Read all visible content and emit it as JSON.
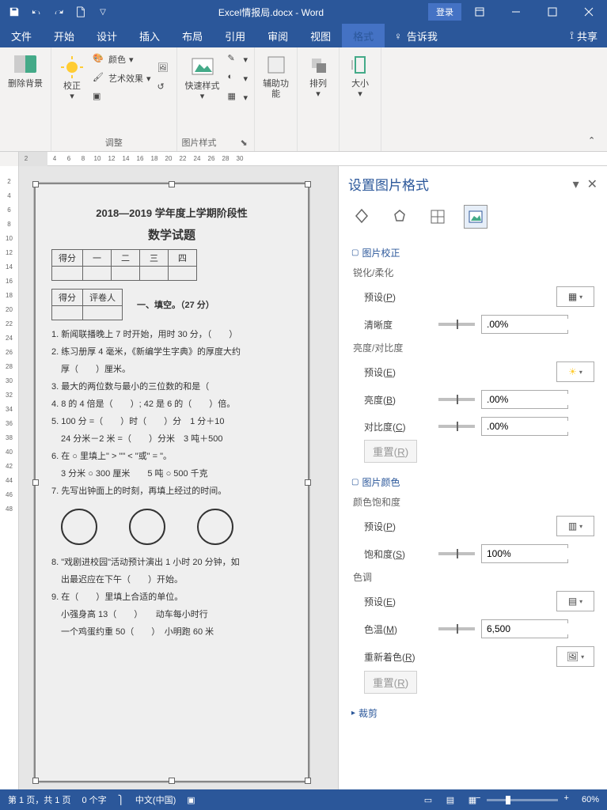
{
  "titlebar": {
    "document_name": "Excel情报局.docx  -  Word",
    "login": "登录"
  },
  "tabs": {
    "file": "文件",
    "home": "开始",
    "design": "设计",
    "insert": "插入",
    "layout": "布局",
    "references": "引用",
    "review": "审阅",
    "view": "视图",
    "format": "格式",
    "tell_me": "告诉我",
    "share": "共享"
  },
  "ribbon": {
    "remove_bg": "删除背景",
    "corrections": "校正",
    "adjust_label": "调整",
    "color": "颜色",
    "artistic": "艺术效果",
    "quick_styles": "快速样式",
    "picture_styles_label": "图片样式",
    "accessibility": "辅助功\n能",
    "arrange": "排列",
    "size": "大小"
  },
  "ruler_h": [
    "2",
    "",
    "4",
    "6",
    "8",
    "10",
    "12",
    "14",
    "16",
    "18",
    "20",
    "22",
    "24",
    "26",
    "28",
    "30"
  ],
  "ruler_v": [
    "2",
    "4",
    "6",
    "8",
    "10",
    "12",
    "14",
    "16",
    "18",
    "20",
    "22",
    "24",
    "26",
    "28",
    "30",
    "32",
    "34",
    "36",
    "38",
    "40",
    "42",
    "44",
    "46",
    "48"
  ],
  "document": {
    "header": "2018—2019 学年度上学期阶段性",
    "subject": "数学试题",
    "row1": [
      "得分",
      "一",
      "二",
      "三",
      "四"
    ],
    "row2": [
      "得分",
      "评卷人"
    ],
    "section1": "一、填空。（27 分）",
    "q1": "1. 新闻联播晚上 7 时开始，用时 30 分，（　　）",
    "q2": "2. 练习册厚 4 毫米，《新编学生字典》的厚度大约",
    "q2b": "厚（　　）厘米。",
    "q3": "3. 最大的两位数与最小的三位数的和是（　　",
    "q4": "4. 8 的 4 倍是（　　）; 42 是 6 的（　　）倍。",
    "q5": "5. 100 分 =（　　）时（　　）分　1 分＋10",
    "q5b": "24 分米－2 米 =（　　）分米　3 吨＋500",
    "q6": "6. 在 ○ 里填上\" > \"\" < \"或\" = \"。",
    "q6b": "3 分米 ○ 300 厘米　　5 吨 ○ 500 千克",
    "q7": "7. 先写出钟面上的时刻，再填上经过的时间。",
    "q8": "8. \"戏剧进校园\"活动预计演出 1 小时 20 分钟，如",
    "q8b": "出最迟应在下午（　　）开始。",
    "q9": "9. 在（　　）里填上合适的单位。",
    "q9b": "小强身高 13（　　）　　动车每小时行",
    "q9c": "一个鸡蛋约重 50（　　）　小明跑 60 米"
  },
  "pane": {
    "title": "设置图片格式",
    "correction": "图片校正",
    "sharpen_soften": "锐化/柔化",
    "preset_p": "预设(P)",
    "clarity": "清晰度",
    "brightness_contrast": "亮度/对比度",
    "preset_e": "预设(E)",
    "brightness": "亮度(B)",
    "contrast": "对比度(C)",
    "reset_r": "重置(R)",
    "picture_color": "图片颜色",
    "saturation_section": "颜色饱和度",
    "saturation": "饱和度(S)",
    "tone": "色调",
    "temperature": "色温(M)",
    "recolor": "重新着色(R)",
    "crop": "裁剪",
    "val_zero": ".00%",
    "val_hundred": "100%",
    "val_temp": "6,500"
  },
  "statusbar": {
    "page": "第 1 页，共 1 页",
    "words": "0 个字",
    "lang": "中文(中国)",
    "zoom": "60%"
  }
}
